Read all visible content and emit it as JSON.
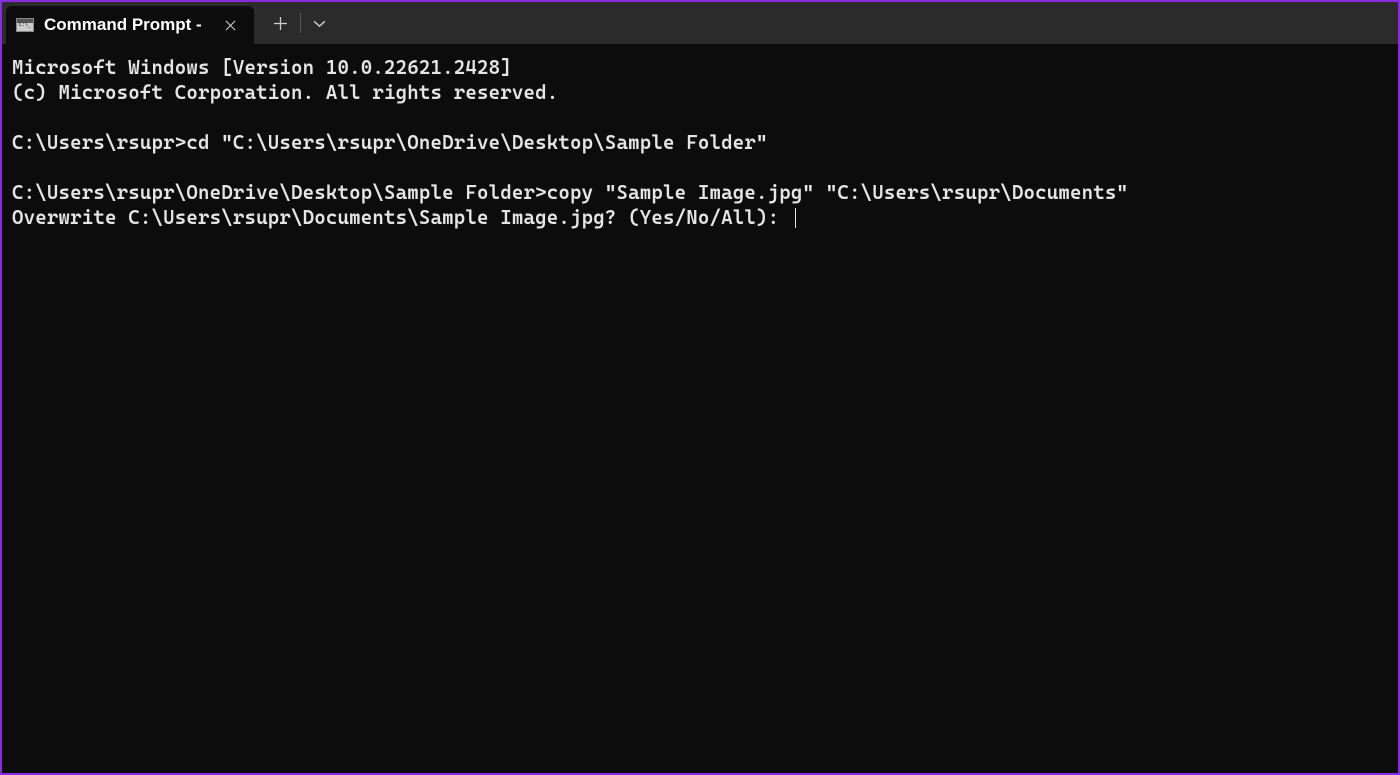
{
  "titlebar": {
    "tab_title": "Command Prompt -"
  },
  "terminal": {
    "line1": "Microsoft Windows [Version 10.0.22621.2428]",
    "line2": "(c) Microsoft Corporation. All rights reserved.",
    "blank1": "",
    "line3": "C:\\Users\\rsupr>cd \"C:\\Users\\rsupr\\OneDrive\\Desktop\\Sample Folder\"",
    "blank2": "",
    "line4": "C:\\Users\\rsupr\\OneDrive\\Desktop\\Sample Folder>copy \"Sample Image.jpg\" \"C:\\Users\\rsupr\\Documents\"",
    "line5": "Overwrite C:\\Users\\rsupr\\Documents\\Sample Image.jpg? (Yes/No/All): "
  }
}
